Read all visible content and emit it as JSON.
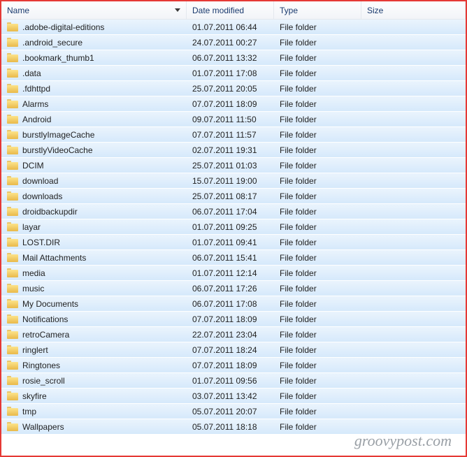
{
  "columns": {
    "name": "Name",
    "date": "Date modified",
    "type": "Type",
    "size": "Size"
  },
  "type_label": "File folder",
  "watermark": "groovypost.com",
  "items": [
    {
      "name": ".adobe-digital-editions",
      "date": "01.07.2011 06:44"
    },
    {
      "name": ".android_secure",
      "date": "24.07.2011 00:27"
    },
    {
      "name": ".bookmark_thumb1",
      "date": "06.07.2011 13:32"
    },
    {
      "name": ".data",
      "date": "01.07.2011 17:08"
    },
    {
      "name": ".fdhttpd",
      "date": "25.07.2011 20:05"
    },
    {
      "name": "Alarms",
      "date": "07.07.2011 18:09"
    },
    {
      "name": "Android",
      "date": "09.07.2011 11:50"
    },
    {
      "name": "burstlyImageCache",
      "date": "07.07.2011 11:57"
    },
    {
      "name": "burstlyVideoCache",
      "date": "02.07.2011 19:31"
    },
    {
      "name": "DCIM",
      "date": "25.07.2011 01:03"
    },
    {
      "name": "download",
      "date": "15.07.2011 19:00"
    },
    {
      "name": "downloads",
      "date": "25.07.2011 08:17"
    },
    {
      "name": "droidbackupdir",
      "date": "06.07.2011 17:04"
    },
    {
      "name": "layar",
      "date": "01.07.2011 09:25"
    },
    {
      "name": "LOST.DIR",
      "date": "01.07.2011 09:41"
    },
    {
      "name": "Mail Attachments",
      "date": "06.07.2011 15:41"
    },
    {
      "name": "media",
      "date": "01.07.2011 12:14"
    },
    {
      "name": "music",
      "date": "06.07.2011 17:26"
    },
    {
      "name": "My Documents",
      "date": "06.07.2011 17:08"
    },
    {
      "name": "Notifications",
      "date": "07.07.2011 18:09"
    },
    {
      "name": "retroCamera",
      "date": "22.07.2011 23:04"
    },
    {
      "name": "ringlert",
      "date": "07.07.2011 18:24"
    },
    {
      "name": "Ringtones",
      "date": "07.07.2011 18:09"
    },
    {
      "name": "rosie_scroll",
      "date": "01.07.2011 09:56"
    },
    {
      "name": "skyfire",
      "date": "03.07.2011 13:42"
    },
    {
      "name": "tmp",
      "date": "05.07.2011 20:07"
    },
    {
      "name": "Wallpapers",
      "date": "05.07.2011 18:18"
    }
  ]
}
